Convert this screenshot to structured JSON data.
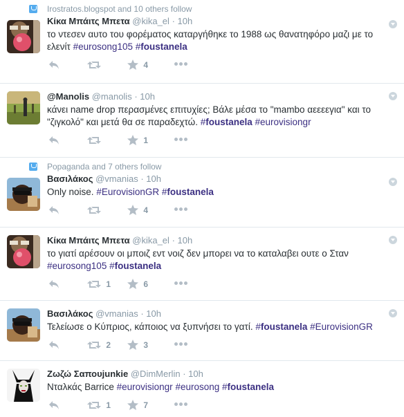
{
  "tweets": [
    {
      "context": "Irostratos.blogspot and 10 others follow",
      "fullname": "Κίκα Μπάιτς Μπετα",
      "username": "@kika_el",
      "dot": "·",
      "time": "10h",
      "text_pre": "το ντεσεν αυτο του φορέματος καταργήθηκε το 1988 ως θανατηφόρο μαζι με το ελενίτ",
      "hashtag1": "#eurosong105",
      "hashtag2_hash": "#",
      "hashtag2_word": "foustanela",
      "retweets": "",
      "favorites": "4",
      "avatar": "red-balloon-avatar"
    },
    {
      "context": "",
      "fullname": "@Manolis",
      "username": "@manolis",
      "dot": "·",
      "time": "10h",
      "text_pre": "κάνει name drop περασμένες επιτυχίες; Βάλε μέσα το \"mambo αεεεεγια\" και το \"ζιγκολό\" και μετά θα σε παραδεχτώ.",
      "hashtag1_hash": "#",
      "hashtag1_word": "foustanela",
      "hashtag2": "#eurovisiongr",
      "retweets": "",
      "favorites": "1",
      "avatar": "field-avatar"
    },
    {
      "context": "Popaganda and 7 others follow",
      "fullname": "Βασιλάκος",
      "username": "@vmanias",
      "dot": "·",
      "time": "10h",
      "text_pre": "Only noise.",
      "hashtag1": "#EurovisionGR",
      "hashtag2_hash": "#",
      "hashtag2_word": "foustanela",
      "retweets": "",
      "favorites": "4",
      "avatar": "sunglasses-avatar"
    },
    {
      "context": "",
      "fullname": "Κίκα Μπάιτς Μπετα",
      "username": "@kika_el",
      "dot": "·",
      "time": "10h",
      "text_pre": "το γιατί αρέσουν οι μποιζ εντ νοιζ δεν μπορει να το καταλαβει ουτε ο Σταν",
      "hashtag1": "#eurosong105",
      "hashtag2_hash": "#",
      "hashtag2_word": "foustanela",
      "retweets": "1",
      "favorites": "6",
      "avatar": "red-balloon-avatar"
    },
    {
      "context": "",
      "fullname": "Βασιλάκος",
      "username": "@vmanias",
      "dot": "·",
      "time": "10h",
      "text_pre": "Τελείωσε ο Κύπριος, κάποιος να ξυπνήσει το γατί.",
      "hashtag1_hash": "#",
      "hashtag1_word": "foustanela",
      "hashtag2": "#EurovisionGR",
      "retweets": "2",
      "favorites": "3",
      "avatar": "sunglasses-avatar"
    },
    {
      "context": "",
      "fullname": "Ζωζώ Σαπουjunkie",
      "username": "@DimMerlin",
      "dot": "·",
      "time": "10h",
      "text_pre": "Νταλκάς Barrice",
      "hashtag1": "#eurovisiongr",
      "hashtag2": "#eurosong",
      "hashtag3_hash": "#",
      "hashtag3_word": "foustanela",
      "retweets": "1",
      "favorites": "7",
      "avatar": "maleficent-avatar"
    }
  ],
  "icons": {
    "reply": "reply-icon",
    "retweet": "retweet-icon",
    "favorite": "star-icon",
    "more": "more-dots-icon",
    "caret": "caret-down-icon",
    "context": "follow-context-icon"
  },
  "colors": {
    "hashtag": "#3b2f82",
    "meta": "#8899a6",
    "border": "#e1e8ed",
    "context_icon": "#55acee"
  }
}
